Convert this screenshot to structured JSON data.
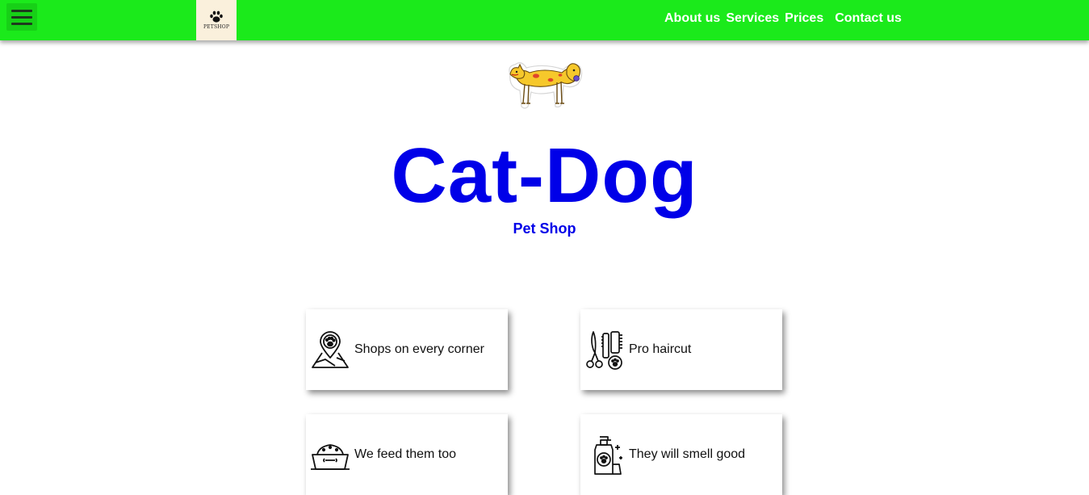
{
  "header": {
    "logo_text": "PETSHOP",
    "nav": {
      "about": "About us",
      "services": "Services",
      "prices": "Prices",
      "contact": "Contact us"
    }
  },
  "hero": {
    "title": "Cat-Dog",
    "subtitle": "Pet Shop"
  },
  "features": [
    {
      "label": "Shops on every corner",
      "icon": "map-pin-paw-icon"
    },
    {
      "label": "Pro haircut",
      "icon": "grooming-tools-icon"
    },
    {
      "label": "We feed them too",
      "icon": "food-bowl-icon"
    },
    {
      "label": "They will smell good",
      "icon": "pet-shampoo-icon"
    }
  ],
  "colors": {
    "header_bg": "#1bea1b",
    "title": "#0000e8",
    "nav_text": "#ffffff"
  }
}
